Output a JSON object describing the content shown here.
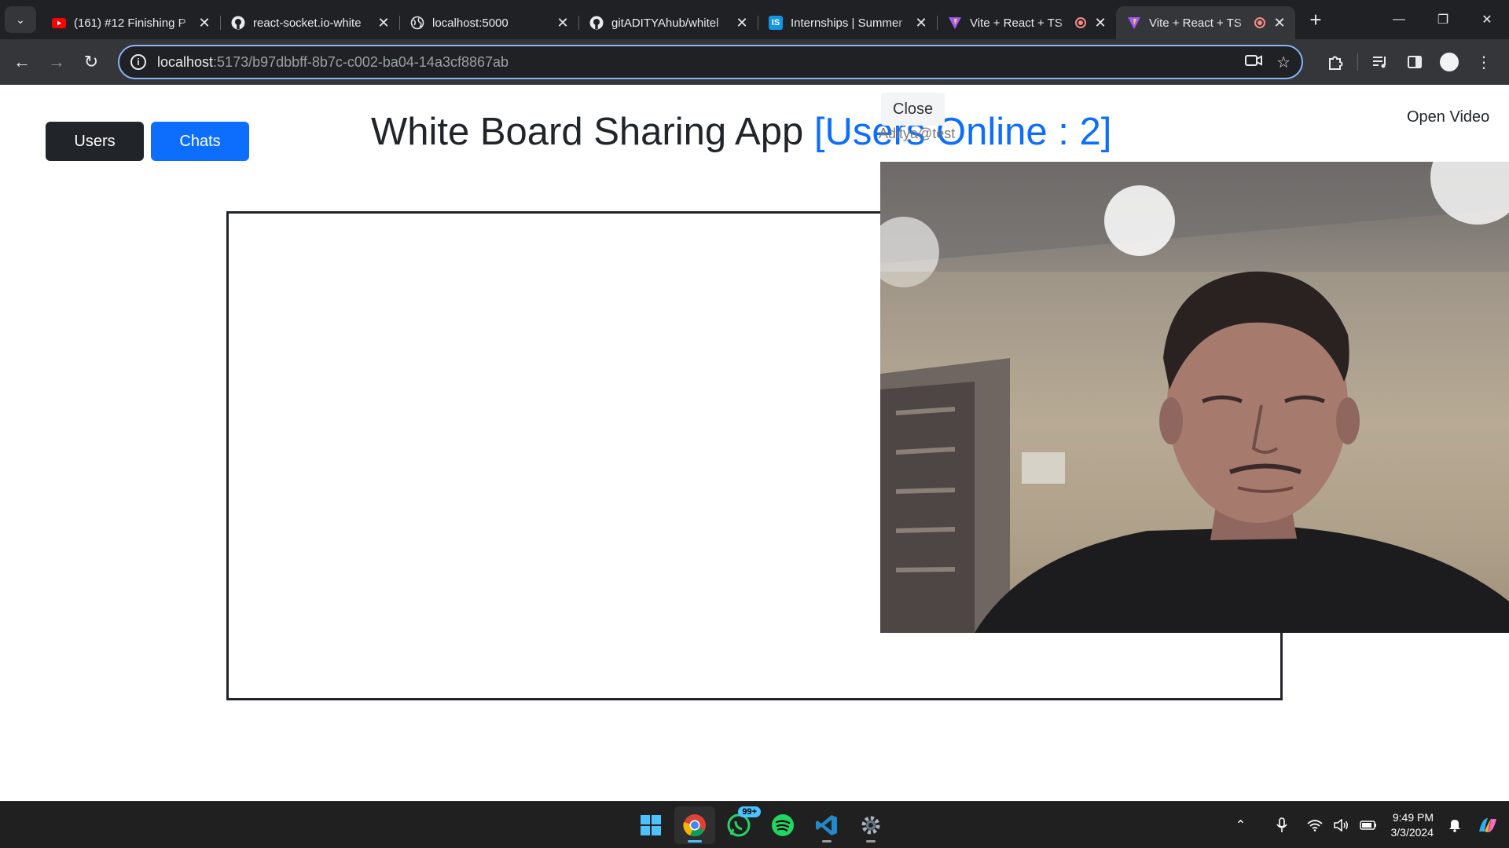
{
  "browser": {
    "tabs": [
      {
        "title": "(161) #12 Finishing P",
        "favicon": "youtube-icon",
        "active": false,
        "recording": false
      },
      {
        "title": "react-socket.io-white",
        "favicon": "github-icon",
        "active": false,
        "recording": false
      },
      {
        "title": "localhost:5000",
        "favicon": "globe-icon",
        "active": false,
        "recording": false
      },
      {
        "title": "gitADITYAhub/whitel",
        "favicon": "github-icon",
        "active": false,
        "recording": false
      },
      {
        "title": "Internships | Summer",
        "favicon": "internshala-icon",
        "favicon_text": "IS",
        "active": false,
        "recording": false
      },
      {
        "title": "Vite + React + TS",
        "favicon": "vite-icon",
        "active": false,
        "recording": true
      },
      {
        "title": "Vite + React + TS",
        "favicon": "vite-icon",
        "active": true,
        "recording": true
      }
    ],
    "url_host": "localhost",
    "url_rest": ":5173/b97dbbff-8b7c-c002-ba04-14a3cf8867ab"
  },
  "app": {
    "users_button": "Users",
    "chats_button": "Chats",
    "title": "White Board Sharing App",
    "online_label": "[Users Online : 2]",
    "open_video": "Open Video",
    "close": "Close",
    "user_tag": "Aditya@test"
  },
  "taskbar": {
    "whatsapp_badge": "99+",
    "time": "9:49 PM",
    "date": "3/3/2024"
  },
  "colors": {
    "primary": "#0d6efd",
    "dark": "#212529",
    "accent": "#8ab4f8"
  }
}
